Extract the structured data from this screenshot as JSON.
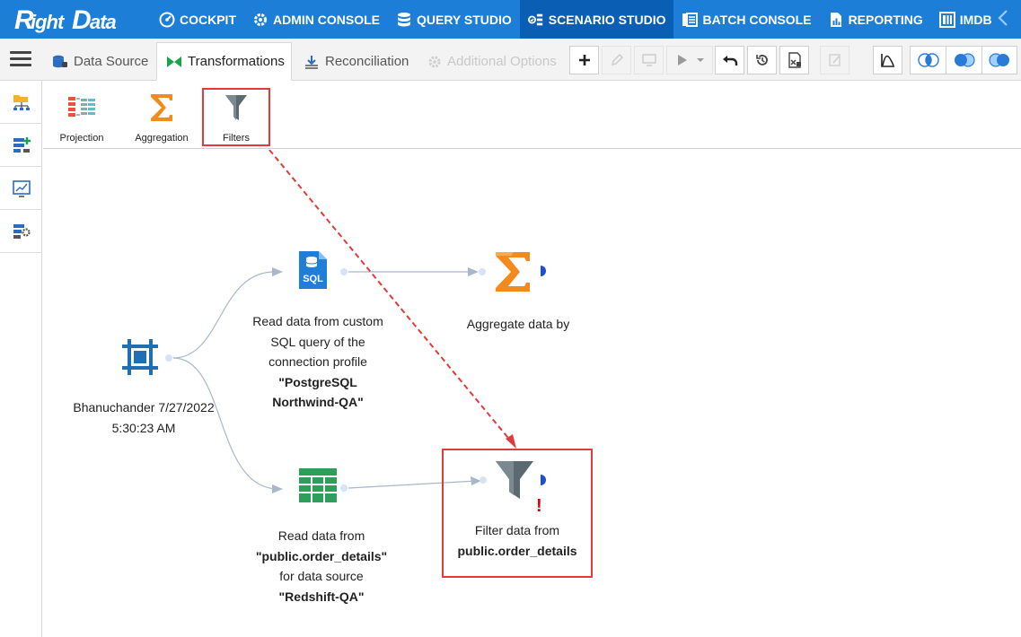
{
  "app": {
    "logo_text": "RightData"
  },
  "nav": {
    "items": [
      {
        "label": "COCKPIT",
        "icon": "cockpit-icon"
      },
      {
        "label": "ADMIN CONSOLE",
        "icon": "gear-icon"
      },
      {
        "label": "QUERY STUDIO",
        "icon": "database-icon"
      },
      {
        "label": "SCENARIO STUDIO",
        "icon": "scenario-icon",
        "active": true
      },
      {
        "label": "BATCH CONSOLE",
        "icon": "batch-icon"
      },
      {
        "label": "REPORTING",
        "icon": "report-icon"
      },
      {
        "label": "IMDB",
        "icon": "imdb-icon"
      }
    ]
  },
  "tabs": [
    {
      "label": "Data Source",
      "icon": "data-source-icon"
    },
    {
      "label": "Transformations",
      "icon": "transformations-icon",
      "active": true
    },
    {
      "label": "Reconciliation",
      "icon": "reconciliation-icon"
    },
    {
      "label": "Additional Options",
      "icon": "additional-options-icon",
      "disabled": true
    }
  ],
  "palette": {
    "items": [
      {
        "label": "Projection",
        "icon": "projection-icon"
      },
      {
        "label": "Aggregation",
        "icon": "sigma-icon"
      },
      {
        "label": "Filters",
        "icon": "filter-icon",
        "highlighted": true
      }
    ]
  },
  "canvas": {
    "nodes": {
      "source": {
        "line1": "Bhanuchander 7/27/2022",
        "line2": "5:30:23 AM"
      },
      "sql": {
        "line1": "Read data from custom",
        "line2": "SQL query of the",
        "line3": "connection profile",
        "line4": "\"PostgreSQL",
        "line5": "Northwind-QA\"",
        "icon_text": "SQL"
      },
      "aggregate": {
        "line1": "Aggregate data by"
      },
      "table": {
        "line1": "Read data from",
        "line2": "\"public.order_details\"",
        "line3": "for data source",
        "line4": "\"Redshift-QA\""
      },
      "filter": {
        "line1": "Filter data from",
        "line2": "public.order_details",
        "warning": "!"
      }
    }
  },
  "colors": {
    "nav_bg": "#1c7ed6",
    "nav_active": "#0a5fb4",
    "highlight": "#e03a3a",
    "sigma": "#f28b1d",
    "table_green": "#2e9e5b",
    "filter_gray": "#5a6a70"
  }
}
